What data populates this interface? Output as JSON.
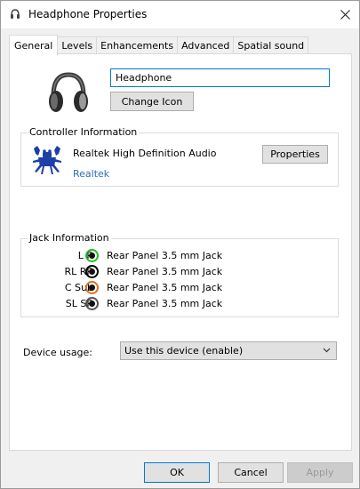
{
  "window": {
    "title": "Headphone Properties",
    "icons": {
      "title": "speaker-icon",
      "close": "close-icon"
    }
  },
  "tabs": [
    {
      "label": "General",
      "active": true
    },
    {
      "label": "Levels",
      "active": false
    },
    {
      "label": "Enhancements",
      "active": false
    },
    {
      "label": "Advanced",
      "active": false
    },
    {
      "label": "Spatial sound",
      "active": false
    }
  ],
  "general": {
    "device_icon": "headphone-icon",
    "name_value": "Headphone",
    "change_icon_label": "Change Icon",
    "controller": {
      "group_label": "Controller Information",
      "logo": "realtek-crab-logo",
      "device_name": "Realtek High Definition Audio",
      "properties_label": "Properties",
      "vendor_link": "Realtek"
    },
    "jack": {
      "group_label": "Jack Information",
      "rows": [
        {
          "channel": "L R",
          "color": "#1fbf22",
          "description": "Rear Panel 3.5 mm Jack"
        },
        {
          "channel": "RL RR",
          "color": "#000000",
          "description": "Rear Panel 3.5 mm Jack"
        },
        {
          "channel": "C Sub",
          "color": "#e0711b",
          "description": "Rear Panel 3.5 mm Jack"
        },
        {
          "channel": "SL SR",
          "color": "#555555",
          "description": "Rear Panel 3.5 mm Jack"
        }
      ]
    },
    "device_usage": {
      "label": "Device usage:",
      "selected": "Use this device (enable)"
    }
  },
  "footer": {
    "ok_label": "OK",
    "cancel_label": "Cancel",
    "apply_label": "Apply"
  },
  "colors": {
    "accent": "#0078d7",
    "link": "#2a6ebb",
    "dialog_bg": "#f0f0f0"
  }
}
